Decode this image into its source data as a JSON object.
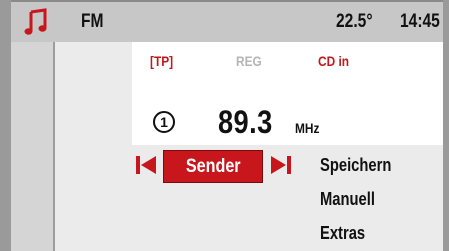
{
  "status_bar": {
    "source_icon": "music-note-icon",
    "band": "FM",
    "temperature": "22.5°",
    "time": "14:45"
  },
  "info_row": {
    "tp": "[TP]",
    "reg": "REG",
    "cd_status": "CD in"
  },
  "station": {
    "preset_number": "1",
    "frequency": "89.3",
    "unit": "MHz"
  },
  "controls": {
    "prev_icon": "skip-previous-icon",
    "sender_label": "Sender",
    "next_icon": "skip-next-icon"
  },
  "menu": {
    "items": [
      "Speichern",
      "Manuell",
      "Extras"
    ]
  },
  "colors": {
    "accent": "#c8161d",
    "inactive_text": "#b5b5b5",
    "status_bar_bg": "#c7c7c7",
    "panel_bg": "#ebebeb"
  }
}
